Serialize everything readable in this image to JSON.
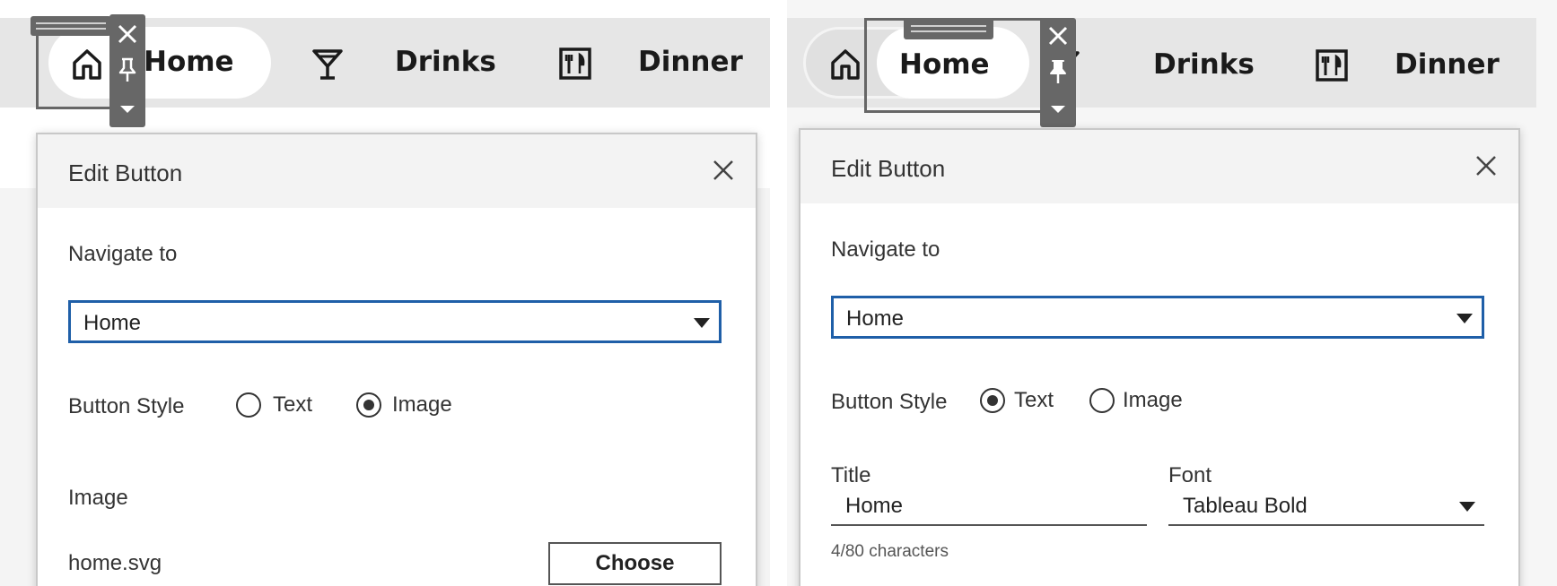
{
  "left": {
    "navbar": {
      "home_label": "Home",
      "drinks_label": "Drinks",
      "dinner_label": "Dinner"
    },
    "dialog": {
      "title": "Edit Button",
      "navigate_label": "Navigate to",
      "navigate_value": "Home",
      "style_label": "Button Style",
      "style_options": [
        "Text",
        "Image"
      ],
      "style_selected": "Image",
      "image_label": "Image",
      "image_file": "home.svg",
      "choose_label": "Choose"
    }
  },
  "right": {
    "navbar": {
      "home_label": "Home",
      "drinks_label": "Drinks",
      "dinner_label": "Dinner"
    },
    "dialog": {
      "title": "Edit Button",
      "navigate_label": "Navigate to",
      "navigate_value": "Home",
      "style_label": "Button Style",
      "style_options": [
        "Text",
        "Image"
      ],
      "style_selected": "Text",
      "title_label": "Title",
      "title_value": "Home",
      "char_count": "4/80 characters",
      "font_label": "Font",
      "font_value": "Tableau Bold"
    }
  },
  "icons": [
    "home-icon",
    "martini-icon",
    "dinner-icon",
    "close-icon",
    "pin-icon",
    "dropdown-arrow-icon",
    "drag-handle-icon"
  ],
  "colors": {
    "accent": "#1f5fa8",
    "toolbar": "#676767",
    "navbar_bg": "#e6e6e6"
  }
}
